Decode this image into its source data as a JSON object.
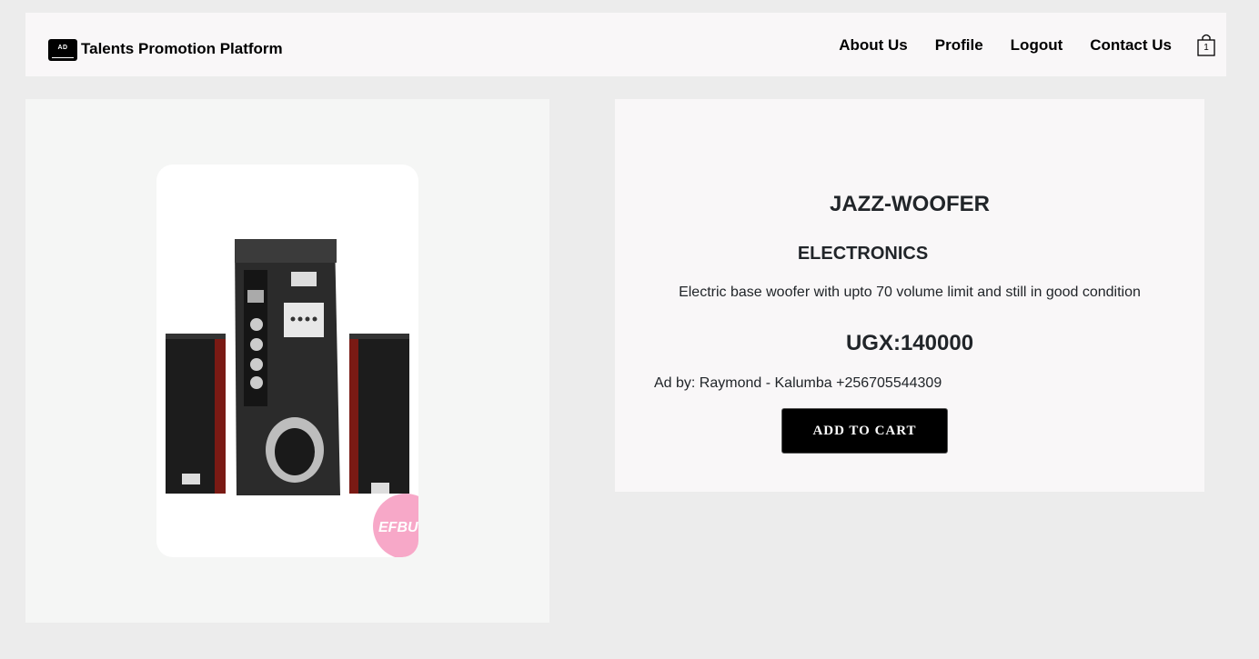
{
  "brand": {
    "logo_text": "AD",
    "name": "Talents Promotion Platform"
  },
  "nav": {
    "items": [
      {
        "label": "About Us"
      },
      {
        "label": "Profile"
      },
      {
        "label": "Logout"
      },
      {
        "label": "Contact Us"
      }
    ],
    "cart_count": "1"
  },
  "product": {
    "image_icon": "speaker-system-image",
    "image_watermark": "EFBUY",
    "title": "JAZZ-WOOFER",
    "category": "ELECTRONICS",
    "description": "Electric base woofer with upto 70 volume limit and still in good condition",
    "price": "UGX:140000",
    "seller": "Ad by: Raymond - Kalumba +256705544309",
    "add_to_cart_label": "ADD TO CART"
  },
  "colors": {
    "page_bg": "#ececec",
    "navbar_bg": "#f9f7f8",
    "button_bg": "#000000",
    "watermark": "#f7a8c8"
  }
}
